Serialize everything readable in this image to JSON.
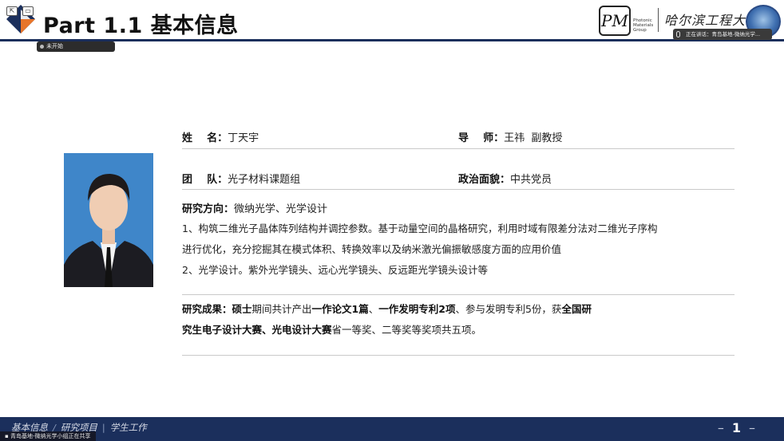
{
  "header": {
    "title": "Part 1.1 基本信息",
    "not_started": "未开始",
    "pm_logo": "PM",
    "pm_text": "Photonic Materials Group",
    "university": "哈尔滨工程大学",
    "meeting_status": "正在讲话：青岛基地-微纳光学..."
  },
  "profile": {
    "name_label": "姓    名：",
    "name_value": "丁天宇",
    "advisor_label": "导    师：",
    "advisor_value": "王祎  副教授",
    "team_label": "团    队：",
    "team_value": "光子材料课题组",
    "politics_label": "政治面貌：",
    "politics_value": "中共党员",
    "direction_label": "研究方向：",
    "direction_value": "微纳光学、光学设计",
    "direction_item1_line1": "1、构筑二维光子晶体阵列结构并调控参数。基于动量空间的晶格研究，利用时域有限差分法对二维光子序构",
    "direction_item1_line2": "进行优化，充分挖掘其在模式体积、转换效率以及纳米激光偏振敏感度方面的应用价值",
    "direction_item2": "2、光学设计。紫外光学镜头、远心光学镜头、反远距光学镜头设计等",
    "results_label": "研究成果：",
    "results_line1_a": "硕士",
    "results_line1_b": "期间共计产出",
    "results_line1_c": "一作论文1篇",
    "results_line1_d": "、",
    "results_line1_e": "一作发明专利2项",
    "results_line1_f": "、参与发明专利5份，获",
    "results_line1_g": "全国研",
    "results_line2_a": "究生电子设计大赛、光电设计大赛",
    "results_line2_b": "省一等奖、二等奖等奖项共五项。"
  },
  "footer": {
    "nav": [
      "基本信息",
      "研究项目",
      "学生工作"
    ],
    "share_note": "青岛基地-微纳光学小组正在共享",
    "page": "1"
  },
  "colors": {
    "navy": "#1b2f5c",
    "photo_bg": "#3f86c9"
  }
}
